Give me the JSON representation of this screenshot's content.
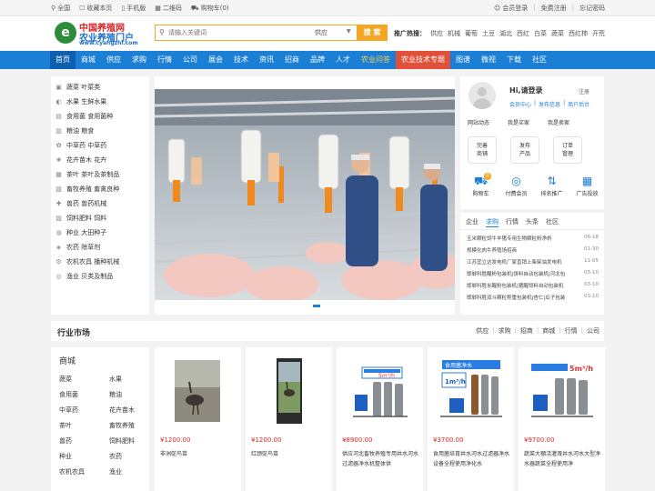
{
  "topbar": {
    "left": [
      "全国",
      "收藏本页",
      "手机版",
      "二维码",
      "购物车(0)"
    ],
    "right": [
      "会员登录",
      "免费注册",
      "忘记密码"
    ]
  },
  "logo": {
    "line1": "中国养殖网",
    "line2": "农业养殖门户",
    "url": "www.cyangzhi.com"
  },
  "search": {
    "placeholder": "请输入关键词",
    "type": "供应",
    "button": "搜 索"
  },
  "hot": {
    "label": "推广热搜：",
    "words": [
      "供应",
      "机械",
      "葡萄",
      "土豆",
      "湖北",
      "西红",
      "白菜",
      "蔬菜",
      "西红柿",
      "开荒"
    ]
  },
  "nav": [
    "首页",
    "商城",
    "供应",
    "求购",
    "行情",
    "公司",
    "展会",
    "技术",
    "资讯",
    "招商",
    "品牌",
    "人才",
    "农业问答",
    "农业技术专题",
    "图谱",
    "微视",
    "下载",
    "社区"
  ],
  "categories": [
    {
      "icon": "▣",
      "label": "蔬菜 叶菜类"
    },
    {
      "icon": "◐",
      "label": "水果 生鲜水果"
    },
    {
      "icon": "▤",
      "label": "食用菌 食用菌种"
    },
    {
      "icon": "▥",
      "label": "粮油 粮食"
    },
    {
      "icon": "✿",
      "label": "中草药 中草药"
    },
    {
      "icon": "❀",
      "label": "花卉苗木 花卉"
    },
    {
      "icon": "▦",
      "label": "茶叶 茶叶及茶制品"
    },
    {
      "icon": "▧",
      "label": "畜牧养殖 畜禽良种"
    },
    {
      "icon": "✚",
      "label": "兽药 兽药机械"
    },
    {
      "icon": "▨",
      "label": "饲料肥料 饲料"
    },
    {
      "icon": "◍",
      "label": "种业 大田种子"
    },
    {
      "icon": "◈",
      "label": "农药 除草剂"
    },
    {
      "icon": "⚙",
      "label": "农机农具 播种机械"
    },
    {
      "icon": "◎",
      "label": "渔业 贝类及制品"
    }
  ],
  "user": {
    "greeting": "Hi,请登录",
    "register": "注册",
    "links": [
      "会员中心",
      "发布信息",
      "商户后台"
    ],
    "actions": [
      "网站动态",
      "我是买家",
      "我是卖家"
    ],
    "features": [
      {
        "line1": "完善",
        "line2": "商铺"
      },
      {
        "line1": "发布",
        "line2": "产品"
      },
      {
        "line1": "订单",
        "line2": "管理"
      }
    ],
    "icons": [
      {
        "glyph": "🛒",
        "label": "购物车"
      },
      {
        "glyph": "◎",
        "label": "付费会员"
      },
      {
        "glyph": "⇅",
        "label": "排名推广"
      },
      {
        "glyph": "▦",
        "label": "广告投放"
      }
    ],
    "cart_count": "0"
  },
  "news": {
    "tabs": [
      "企业",
      "求购",
      "行情",
      "头条",
      "社区"
    ],
    "active_tab": 1,
    "items": [
      {
        "title": "玉米颗粒饲牛羊猪专用生物颗粒粉净刹",
        "date": "06-18"
      },
      {
        "title": "规模化肉牛养殖场招商",
        "date": "01-30"
      },
      {
        "title": "江苏宜立达发电机厂家直销上柴柴油发电机",
        "date": "11-05"
      },
      {
        "title": "邯郸科胜醒粉包装机|饼料自动包装机|河北包",
        "date": "03-10"
      },
      {
        "title": "邯郸科胜米醒粉包装机|猪醒饲料自动包装机",
        "date": "03-10"
      },
      {
        "title": "邯郸科胜双斗颗粒称重包装机|杏仁|瓜子包装",
        "date": "03-10"
      }
    ]
  },
  "industry": {
    "title": "行业市场",
    "links": [
      "供应",
      "求购",
      "招商",
      "商城",
      "行情",
      "公司"
    ]
  },
  "category_box": {
    "title": "商城",
    "items": [
      "蔬菜",
      "水果",
      "食用菌",
      "粮油",
      "中草药",
      "花卉苗木",
      "茶叶",
      "畜牧养殖",
      "兽药",
      "饲料肥料",
      "种业",
      "农药",
      "农机农具",
      "渔业"
    ]
  },
  "products": [
    {
      "price": "¥1200.00",
      "name": "非洲鸵鸟苗"
    },
    {
      "price": "¥1200.00",
      "name": "红颈鸵鸟苗"
    },
    {
      "price": "¥8900.00",
      "name": "供应河北畜牧养殖专用井水河水过滤器净水机整体供"
    },
    {
      "price": "¥3700.00",
      "name": "食用菌培育井水河水过滤器净水设备全程使用净化水"
    },
    {
      "price": "¥9700.00",
      "name": "蔬菜大棚浇灌溉井水河水大型净水器蔬菜全程使用净"
    }
  ],
  "colors": {
    "brand_blue": "#1b7fd6",
    "accent_orange": "#f5a623",
    "price_red": "#e2231a"
  }
}
